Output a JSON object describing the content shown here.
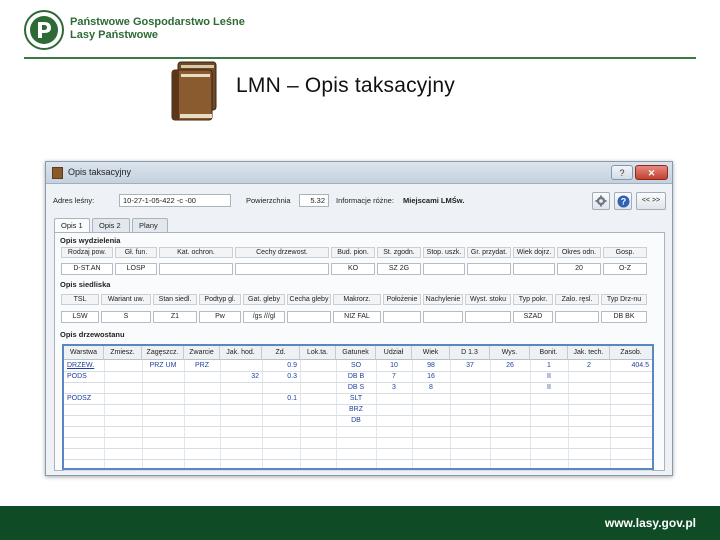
{
  "org": {
    "line1": "Państwowe Gospodarstwo Leśne",
    "line2": "Lasy Państwowe",
    "logo_text": "LASY PAŃSTWOWE"
  },
  "slide_title": "LMN – Opis taksacyjny",
  "window": {
    "title": "Opis taksacyjny",
    "help_btn": "?",
    "close_btn": "✕",
    "adres_label": "Adres leśny:",
    "adres_value": "10-27-1-05-422 -c -00",
    "pow_label": "Powierzchnia",
    "pow_value": "5.32",
    "info_label": "Informacje różne:",
    "info_value": "Miejscami LMŚw.",
    "nav_btn": "<< >>",
    "tabs": [
      "Opis 1",
      "Opis 2",
      "Plany"
    ]
  },
  "sections": {
    "wydzielenia": {
      "title": "Opis wydzielenia",
      "headers": [
        "Rodzaj pow.",
        "Gł. fun.",
        "Kat. ochron.",
        "Cechy drzewost.",
        "Bud. pion.",
        "St. zgodn.",
        "Stop. uszk.",
        "Gr. przydat.",
        "Wiek dojrz.",
        "Okres odn.",
        "Gosp."
      ],
      "values": [
        "D-ST.AN",
        "LOSP",
        "",
        "",
        "KO",
        "SZ 2G",
        "",
        "",
        "",
        "20",
        "O-Z"
      ]
    },
    "siedliska": {
      "title": "Opis siedliska",
      "headers": [
        "TSL",
        "Wariant uw.",
        "Stan siedl.",
        "Podtyp gl.",
        "Gat. gleby",
        "Cecha gleby",
        "Makrorz.",
        "Położenie",
        "Nachylenie",
        "Wyst. stoku",
        "Typ pokr.",
        "Zalo. ręsl.",
        "Typ Drz-nu"
      ],
      "values": [
        "LŚW",
        "Ś",
        "Z1",
        "Pw",
        "/gs ///gl",
        "",
        "NIZ FAL",
        "",
        "",
        "",
        "SZAD",
        "",
        "DB BK"
      ]
    },
    "drzewostanu": {
      "title": "Opis drzewostanu",
      "headers": [
        "Warstwa",
        "Zmiesz.",
        "Zagęszcz.",
        "Zwarcie",
        "Jak. hod.",
        "Zd.",
        "Lok.ta.",
        "Gatunek",
        "Udział",
        "Wiek",
        "D 1.3",
        "Wys.",
        "Bonit.",
        "Jak. tech.",
        "Zasob."
      ],
      "rows": [
        [
          "DRZEW.",
          "",
          "PRZ UM",
          "PRZ",
          "",
          "0.9",
          "",
          "SO",
          "10",
          "98",
          "37",
          "26",
          "1",
          "2",
          "404.5"
        ],
        [
          "PODS",
          "",
          "",
          "",
          "32",
          "0.3",
          "",
          "DB B",
          "7",
          "16",
          "",
          "",
          "II",
          "",
          ""
        ],
        [
          "",
          "",
          "",
          "",
          "",
          "",
          "",
          "DB S",
          "3",
          "8",
          "",
          "",
          "II",
          "",
          ""
        ],
        [
          "PODSZ",
          "",
          "",
          "",
          "",
          "0.1",
          "",
          "ŚLT",
          "",
          "",
          "",
          "",
          "",
          "",
          ""
        ],
        [
          "",
          "",
          "",
          "",
          "",
          "",
          "",
          "BRZ",
          "",
          "",
          "",
          "",
          "",
          "",
          ""
        ],
        [
          "",
          "",
          "",
          "",
          "",
          "",
          "",
          "DB",
          "",
          "",
          "",
          "",
          "",
          "",
          ""
        ]
      ]
    }
  },
  "footer_url": "www.lasy.gov.pl"
}
